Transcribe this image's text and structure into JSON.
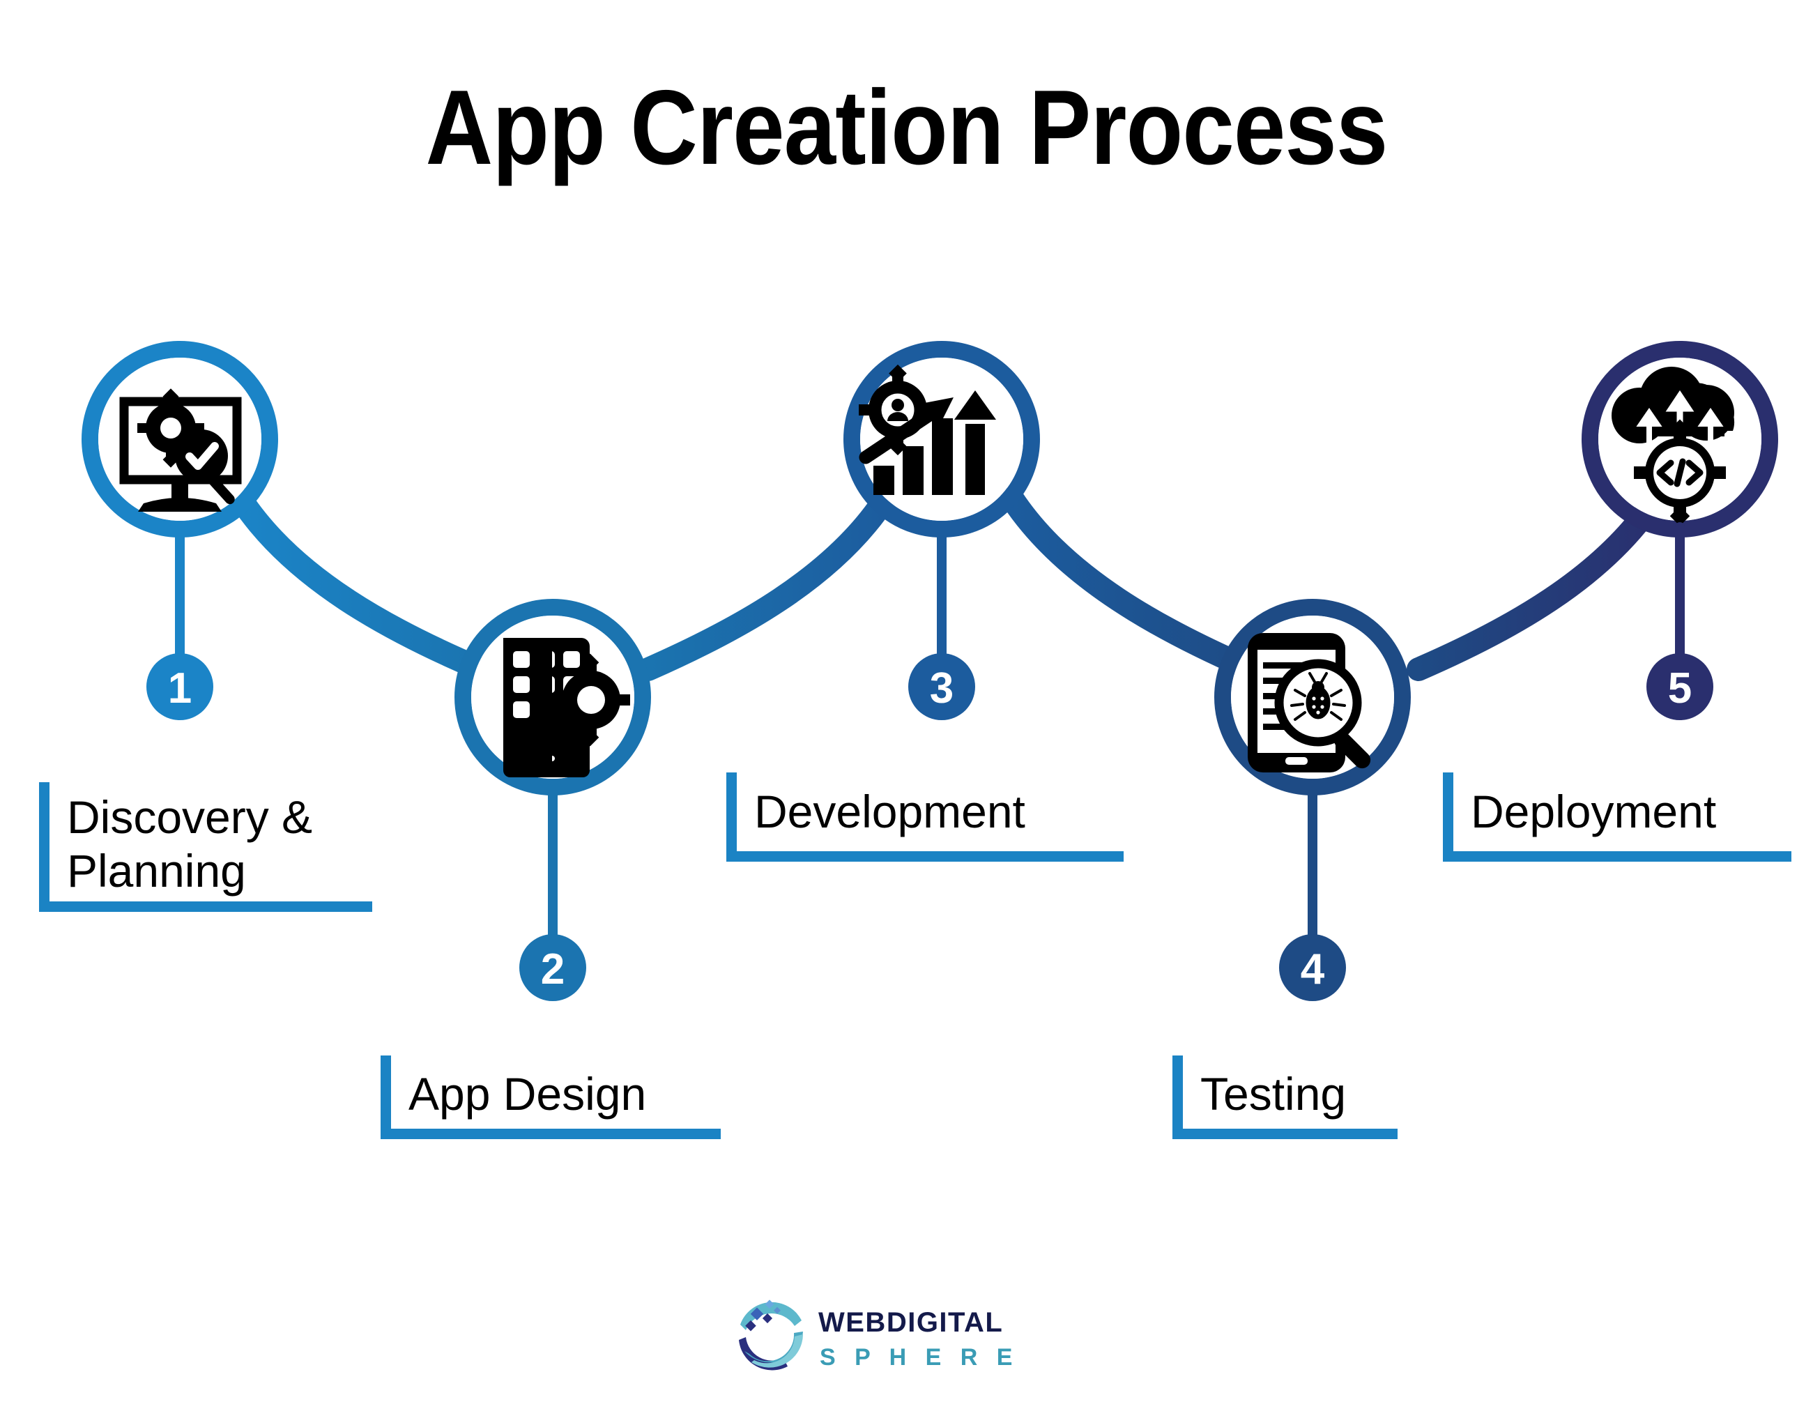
{
  "page": {
    "title": "App Creation Process",
    "background_color": "#ffffff",
    "title_color": "#000000"
  },
  "palette": {
    "step1": "#1b84c7",
    "step2": "#1b74b0",
    "step3": "#1c5c9e",
    "step4": "#1e4b85",
    "step5": "#2a2f6e",
    "bracket": "#1b83c4",
    "icon": "#000000",
    "badge_text": "#ffffff"
  },
  "steps": [
    {
      "number": "1",
      "label": "Discovery &\nPlanning",
      "label_lines": [
        "Discovery &",
        "Planning"
      ],
      "icon_name": "monitor-gear-magnifier-check-icon",
      "color": "#1b84c7",
      "position": "up"
    },
    {
      "number": "2",
      "label": "App Design",
      "label_lines": [
        "App Design"
      ],
      "icon_name": "smartphone-app-grid-gear-icon",
      "color": "#1b74b0",
      "position": "down"
    },
    {
      "number": "3",
      "label": "Development",
      "label_lines": [
        "Development"
      ],
      "icon_name": "growth-bar-chart-arrow-gear-user-icon",
      "color": "#1c5c9e",
      "position": "up"
    },
    {
      "number": "4",
      "label": "Testing",
      "label_lines": [
        "Testing"
      ],
      "icon_name": "smartphone-bug-magnifier-icon",
      "color": "#1e4b85",
      "position": "down"
    },
    {
      "number": "5",
      "label": "Deployment",
      "label_lines": [
        "Deployment"
      ],
      "icon_name": "cloud-upload-code-gear-icon",
      "color": "#2a2f6e",
      "position": "up"
    }
  ],
  "logo": {
    "mark_name": "globe-sphere-logo-icon",
    "line1": "WEBDIGITAL",
    "line2": "S P H E R E",
    "line1_color": "#141a4a",
    "line2_color": "#3a9cb5"
  }
}
